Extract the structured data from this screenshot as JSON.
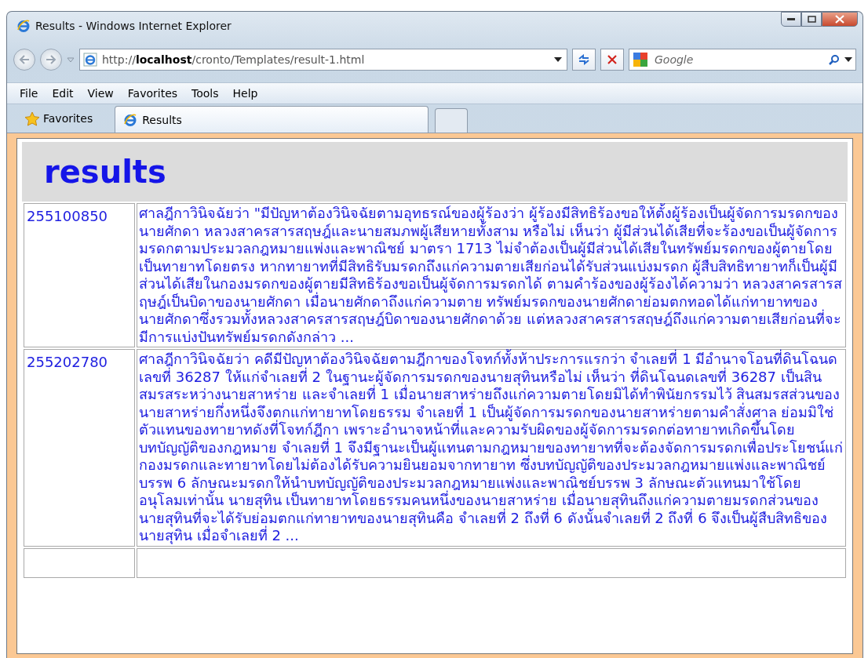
{
  "window": {
    "title": "Results - Windows Internet Explorer"
  },
  "address_bar": {
    "url": "http://**localhost**/cronto/Templates/result-1.html"
  },
  "search": {
    "placeholder": "Google"
  },
  "menu": [
    {
      "label": "File"
    },
    {
      "label": "Edit"
    },
    {
      "label": "View"
    },
    {
      "label": "Favorites"
    },
    {
      "label": "Tools"
    },
    {
      "label": "Help"
    }
  ],
  "favorites_button": {
    "label": "Favorites"
  },
  "tabs": [
    {
      "label": "Results",
      "selected": true
    }
  ],
  "page": {
    "heading": "results",
    "rows": [
      {
        "id": "255100850",
        "text": "ศาลฎีกาวินิจฉัยว่า \"มีปัญหาต้องวินิจฉัยตามอุทธรณ์ของผู้ร้องว่า ผู้ร้องมีสิทธิร้องขอให้ตั้งผู้ร้องเป็นผู้จัดการมรดกของนายศักดา หลวงสาครสารสฤษฎ์และนายสมภพผู้เสียหายทั้งสาม หรือไม่ เห็นว่า ผู้มีส่วนได้เสียที่จะร้องขอเป็นผู้จัดการมรดกตามประมวลกฎหมายแพ่งและพาณิชย์ มาตรา 1713 ไม่จำต้องเป็นผู้มีส่วนได้เสียในทรัพย์มรดกของผู้ตายโดยเป็นทายาทโดยตรง หากทายาทที่มีสิทธิรับมรดกถึงแก่ความตายเสียก่อนได้รับส่วนแบ่งมรดก ผู้สืบสิทธิทายาทก็เป็นผู้มีส่วนได้เสียในกองมรดกของผู้ตายมีสิทธิร้องขอเป็นผู้จัดการมรดกได้ ตามคำร้องของผู้ร้องได้ความว่า หลวงสาครสารสฤษฎ์เป็นบิดาของนายศักดา เมื่อนายศักดาถึงแก่ความตาย ทรัพย์มรดกของนายศักดาย่อมตกทอดได้แก่ทายาทของนายศักดาซึ่งรวมทั้งหลวงสาครสารสฤษฎ์บิดาของนายศักดาด้วย แต่หลวงสาครสารสฤษฎ์ถึงแก่ความตายเสียก่อนที่จะมีการแบ่งปันทรัพย์มรดกดังกล่าว ..."
      },
      {
        "id": "255202780",
        "text": "ศาลฎีกาวินิจฉัยว่า คดีมีปัญหาต้องวินิจฉัยตามฎีกาของโจทก์ทั้งห้าประการแรกว่า จำเลยที่ 1 มีอำนาจโอนที่ดินโฉนดเลขที่ 36287 ให้แก่จำเลยที่ 2 ในฐานะผู้จัดการมรดกของนายสุทินหรือไม่ เห็นว่า ที่ดินโฉนดเลขที่ 36287 เป็นสินสมรสระหว่างนายสาหร่าย และจำเลยที่ 1 เมื่อนายสาหร่ายถึงแก่ความตายโดยมิได้ทำพินัยกรรมไว้ สินสมรสส่วนของนายสาหร่ายกึ่งหนึ่งจึงตกแก่ทายาทโดยธรรม จำเลยที่ 1 เป็นผู้จัดการมรดกของนายสาหร่ายตามคำสั่งศาล ย่อมมิใช่ตัวแทนของทายาทดังที่โจทก์ฎีกา เพราะอำนาจหน้าที่และความรับผิดของผู้จัดการมรดกต่อทายาทเกิดขึ้นโดยบทบัญญัติของกฎหมาย จำเลยที่ 1 จึงมีฐานะเป็นผู้แทนตามกฎหมายของทายาทที่จะต้องจัดการมรดกเพื่อประโยชน์แก่กองมรดกและทายาทโดยไม่ต้องได้รับความยินยอมจากทายาท ซึ่งบทบัญญัติของประมวลกฎหมายแพ่งและพาณิชย์บรรพ 6 ลักษณะมรดกให้นำบทบัญญัติของประมวลกฎหมายแพ่งและพาณิชย์บรรพ 3 ลักษณะตัวแทนมาใช้โดยอนุโลมเท่านั้น นายสุทิน เป็นทายาทโดยธรรมคนหนึ่งของนายสาหร่าย เมื่อนายสุทินถึงแก่ความตายมรดกส่วนของนายสุทินที่จะได้รับย่อมตกแก่ทายาทของนายสุทินคือ จำเลยที่ 2 ถึงที่ 6 ดังนั้นจำเลยที่ 2 ถึงที่ 6 จึงเป็นผู้สืบสิทธิของนายสุทิน เมื่อจำเลยที่ 2 ..."
      }
    ]
  }
}
